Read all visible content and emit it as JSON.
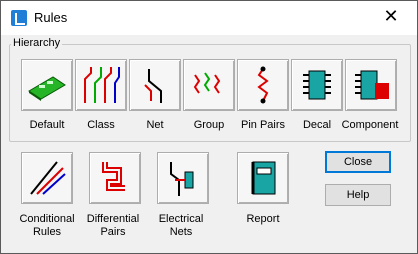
{
  "window": {
    "title": "Rules"
  },
  "hierarchy": {
    "group_label": "Hierarchy",
    "items": [
      "Default",
      "Class",
      "Net",
      "Group",
      "Pin Pairs",
      "Decal",
      "Component"
    ]
  },
  "other_rules": {
    "conditional": [
      "Conditional",
      "Rules"
    ],
    "differential": [
      "Differential",
      "Pairs"
    ],
    "electrical": [
      "Electrical",
      "Nets"
    ],
    "report": "Report"
  },
  "buttons": {
    "close": "Close",
    "help": "Help"
  },
  "colors": {
    "accent": "#0078d7"
  }
}
